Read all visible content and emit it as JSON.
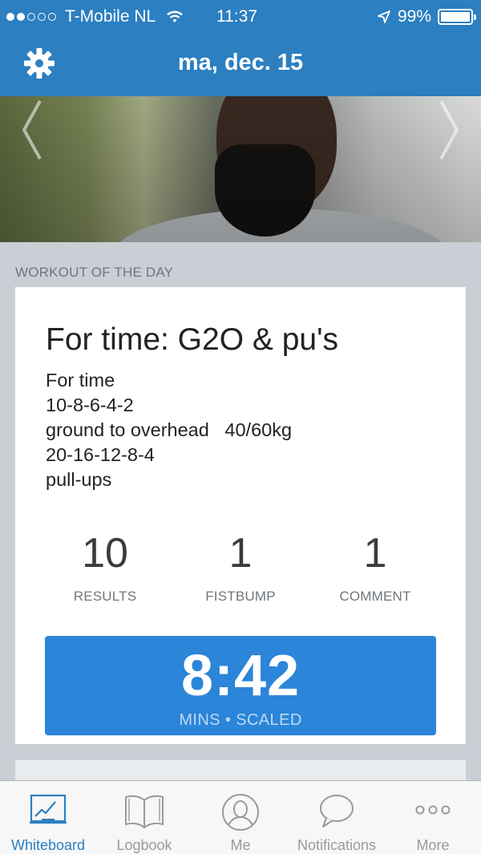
{
  "status_bar": {
    "carrier": "T-Mobile NL",
    "time": "11:37",
    "battery": "99%",
    "signal_bars_filled": 2,
    "signal_bars_total": 5
  },
  "nav": {
    "title": "ma, dec. 15",
    "settings_icon": "gear-icon"
  },
  "banner": {
    "prev_icon": "chevron-left-icon",
    "next_icon": "chevron-right-icon"
  },
  "section": {
    "label": "WORKOUT OF THE DAY"
  },
  "workout": {
    "title": "For time: G2O & pu's",
    "description": [
      "For time",
      "10-8-6-4-2",
      "ground to overhead   40/60kg",
      "20-16-12-8-4",
      "pull-ups"
    ],
    "stats": [
      {
        "value": "10",
        "label": "RESULTS"
      },
      {
        "value": "1",
        "label": "FISTBUMP"
      },
      {
        "value": "1",
        "label": "COMMENT"
      }
    ],
    "score": {
      "value": "8:42",
      "subtitle": "MINS • SCALED"
    }
  },
  "tabs": [
    {
      "label": "Whiteboard",
      "icon": "whiteboard-icon",
      "active": true
    },
    {
      "label": "Logbook",
      "icon": "book-icon",
      "active": false
    },
    {
      "label": "Me",
      "icon": "person-icon",
      "active": false
    },
    {
      "label": "Notifications",
      "icon": "speech-bubble-icon",
      "active": false
    },
    {
      "label": "More",
      "icon": "more-icon",
      "active": false
    }
  ],
  "colors": {
    "brand": "#2c7fc0",
    "score_button": "#2b85d8",
    "background": "#c9cfd4"
  }
}
